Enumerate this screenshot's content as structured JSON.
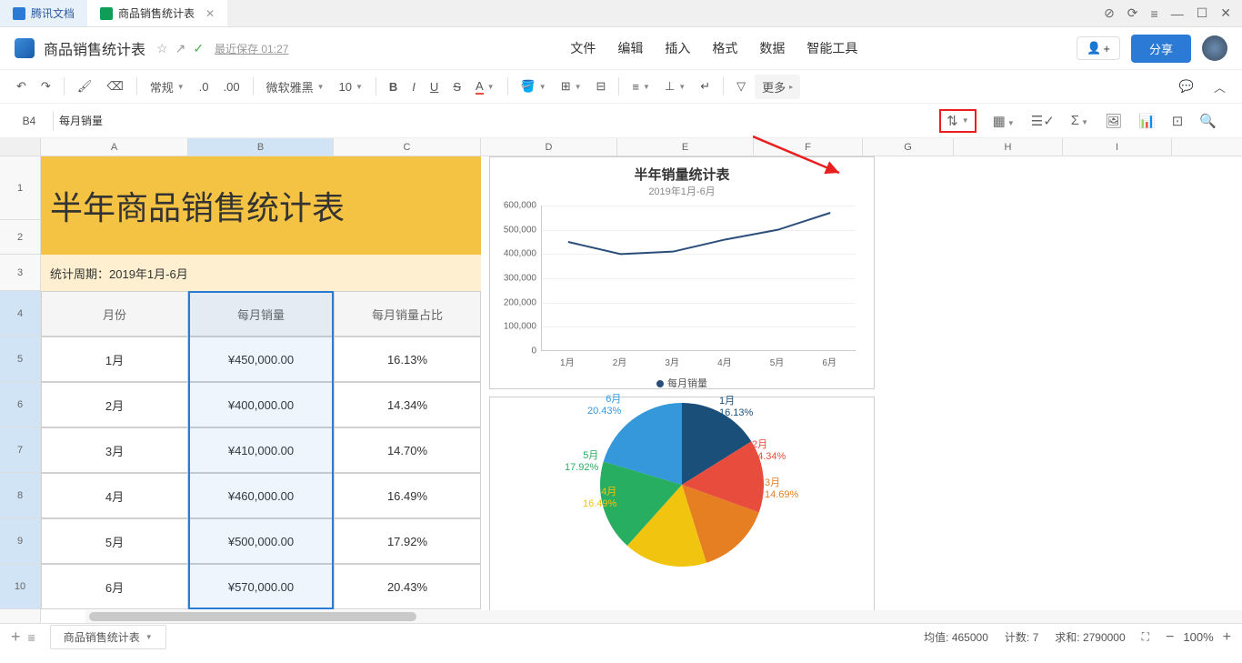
{
  "tabs": {
    "app": "腾讯文档",
    "doc": "商品销售统计表"
  },
  "window_controls": {
    "min": "—",
    "max": "☐",
    "close": "✕"
  },
  "title": {
    "doc_name": "商品销售统计表",
    "save_status": "最近保存 01:27"
  },
  "menus": [
    "文件",
    "编辑",
    "插入",
    "格式",
    "数据",
    "智能工具"
  ],
  "title_actions": {
    "share": "分享"
  },
  "toolbar": {
    "format_style": "常规",
    "font": "微软雅黑",
    "font_size": "10",
    "more": "更多"
  },
  "cell_ref": "B4",
  "formula_bar": "每月销量",
  "sheet": {
    "columns": [
      "A",
      "B",
      "C",
      "D",
      "E",
      "F",
      "G",
      "H",
      "I"
    ],
    "rows": [
      "1",
      "2",
      "3",
      "4",
      "5",
      "6",
      "7",
      "8",
      "9",
      "10"
    ],
    "title_text": "半年商品销售统计表",
    "period_text": "统计周期：2019年1月-6月",
    "headers": [
      "月份",
      "每月销量",
      "每月销量占比"
    ],
    "data_rows": [
      [
        "1月",
        "¥450,000.00",
        "16.13%"
      ],
      [
        "2月",
        "¥400,000.00",
        "14.34%"
      ],
      [
        "3月",
        "¥410,000.00",
        "14.70%"
      ],
      [
        "4月",
        "¥460,000.00",
        "16.49%"
      ],
      [
        "5月",
        "¥500,000.00",
        "17.92%"
      ],
      [
        "6月",
        "¥570,000.00",
        "20.43%"
      ]
    ]
  },
  "chart_data": [
    {
      "type": "line",
      "title": "半年销量统计表",
      "subtitle": "2019年1月-6月",
      "categories": [
        "1月",
        "2月",
        "3月",
        "4月",
        "5月",
        "6月"
      ],
      "series": [
        {
          "name": "每月销量",
          "values": [
            450000,
            400000,
            410000,
            460000,
            500000,
            570000
          ]
        }
      ],
      "ylim": [
        0,
        600000
      ],
      "yticks": [
        0,
        100000,
        200000,
        300000,
        400000,
        500000,
        600000
      ],
      "ytick_labels": [
        "0",
        "100,000",
        "200,000",
        "300,000",
        "400,000",
        "500,000",
        "600,000"
      ],
      "legend": "每月销量"
    },
    {
      "type": "pie",
      "slices": [
        {
          "label": "1月",
          "pct": "16.13%",
          "value": 16.13,
          "color": "#1a4f7a"
        },
        {
          "label": "2月",
          "pct": "14.34%",
          "value": 14.34,
          "color": "#e74c3c"
        },
        {
          "label": "3月",
          "pct": "14.69%",
          "value": 14.69,
          "color": "#e67e22"
        },
        {
          "label": "4月",
          "pct": "16.49%",
          "value": 16.49,
          "color": "#f1c40f"
        },
        {
          "label": "5月",
          "pct": "17.92%",
          "value": 17.92,
          "color": "#27ae60"
        },
        {
          "label": "6月",
          "pct": "20.43%",
          "value": 20.43,
          "color": "#3498db"
        }
      ]
    }
  ],
  "bottom": {
    "sheet_tab": "商品销售统计表",
    "avg_label": "均值:",
    "avg_value": "465000",
    "count_label": "计数:",
    "count_value": "7",
    "sum_label": "求和:",
    "sum_value": "2790000",
    "zoom": "100%"
  }
}
